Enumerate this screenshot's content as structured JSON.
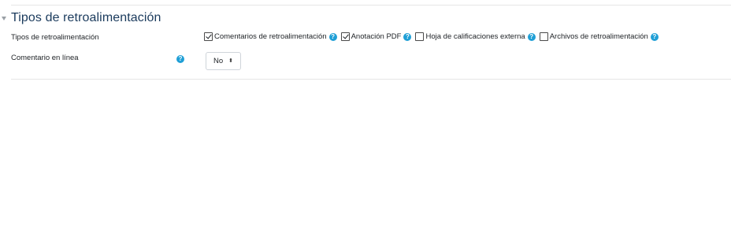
{
  "section": {
    "title": "Tipos de retroalimentación",
    "collapse_icon": "chevron-down-icon"
  },
  "feedback_types": {
    "label": "Tipos de retroalimentación",
    "options": [
      {
        "label": "Comentarios de retroalimentación",
        "checked": true,
        "help": "?"
      },
      {
        "label": "Anotación PDF",
        "checked": true,
        "help": "?"
      },
      {
        "label": "Hoja de calificaciones externa",
        "checked": false,
        "help": "?"
      },
      {
        "label": "Archivos de retroalimentación",
        "checked": false,
        "help": "?"
      }
    ]
  },
  "inline_comment": {
    "label": "Comentario en línea",
    "help": "?",
    "value": "No",
    "caret": "⬍"
  },
  "colors": {
    "title": "#1a3a5c",
    "help_icon": "#1f9fd6"
  }
}
